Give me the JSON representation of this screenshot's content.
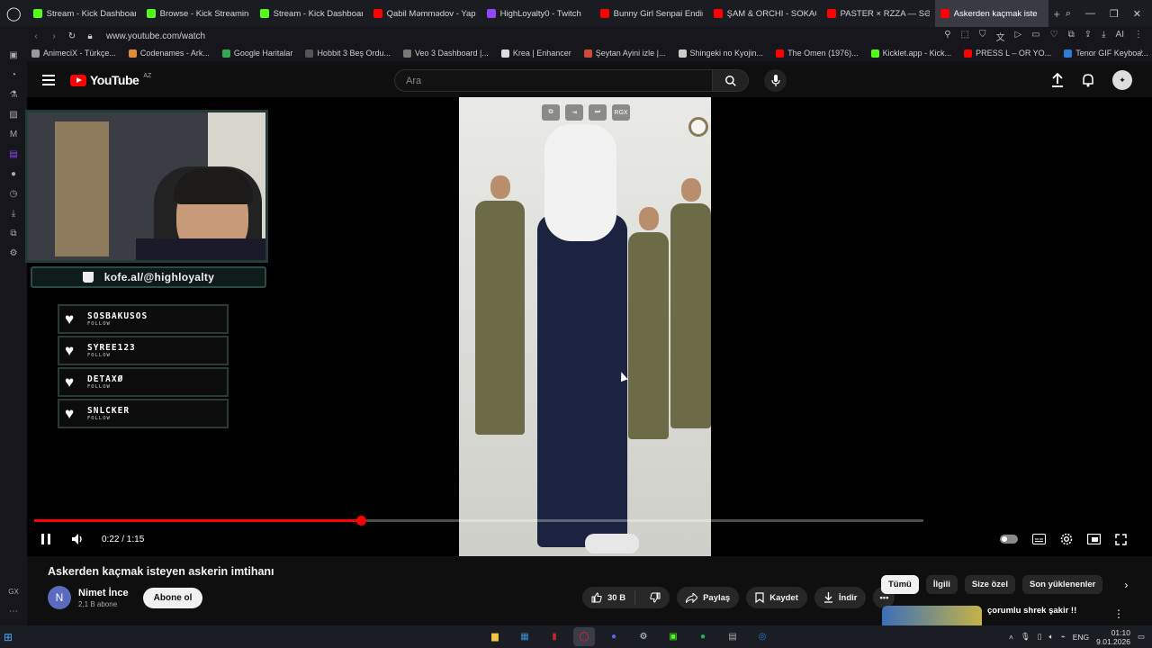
{
  "browser": {
    "tabs": [
      {
        "label": "Stream - Kick Dashboard",
        "color": "#53fc18"
      },
      {
        "label": "Browse - Kick Streaming",
        "color": "#53fc18"
      },
      {
        "label": "Stream - Kick Dashboard",
        "color": "#53fc18"
      },
      {
        "label": "Qabil Məmmədov - Yapar",
        "color": "#ff0000"
      },
      {
        "label": "HighLoyalty0 - Twitch",
        "color": "#9146ff"
      },
      {
        "label": "Bunny Girl Senpai Ending",
        "color": "#ff0000"
      },
      {
        "label": "ŞAM & ORCHI - SOKAĞIN",
        "color": "#ff0000"
      },
      {
        "label": "PASTER × RZZA — SƏNƏ",
        "color": "#ff0000"
      },
      {
        "label": "Askerden kaçmak iste",
        "color": "#ff0000",
        "active": true
      }
    ],
    "url": "www.youtube.com/watch",
    "bookmarks": [
      {
        "label": "AnimeciX - Türkçe...",
        "color": "#999999"
      },
      {
        "label": "Codenames - Ark...",
        "color": "#e08a3c"
      },
      {
        "label": "Google Haritalar",
        "color": "#34a853"
      },
      {
        "label": "Hobbit 3 Beş Ordu...",
        "color": "#555555"
      },
      {
        "label": "Veo 3 Dashboard |...",
        "color": "#777777"
      },
      {
        "label": "Krea | Enhancer",
        "color": "#dddddd"
      },
      {
        "label": "Şeytan Ayini izle |...",
        "color": "#d14836"
      },
      {
        "label": "Shingeki no Kyojin...",
        "color": "#cccccc"
      },
      {
        "label": "The Omen (1976)...",
        "color": "#ff0000"
      },
      {
        "label": "Kicklet.app - Kick...",
        "color": "#53fc18"
      },
      {
        "label": "PRESS L – OR YO...",
        "color": "#ff0000"
      },
      {
        "label": "Tenor GIF Keyboa...",
        "color": "#2f7bd8"
      }
    ]
  },
  "youtube": {
    "logo": "YouTube",
    "region": "AZ",
    "search_placeholder": "Ara",
    "video": {
      "title": "Askerden kaçmak isteyen askerin imtihanı",
      "time_current": "0:22",
      "time_total": "1:15",
      "time_display": "0:22 / 1:15",
      "progress_fraction": 0.367,
      "overlay_badge": "RGX"
    },
    "channel": {
      "initial": "N",
      "name": "Nimet İnce",
      "subscribers": "2,1 B abone",
      "subscribe_label": "Abone ol"
    },
    "actions": {
      "likes": "30 B",
      "share": "Paylaş",
      "save": "Kaydet",
      "download": "İndir"
    },
    "chips": [
      "Tümü",
      "İlgili",
      "Size özel",
      "Son yüklenenler"
    ],
    "recommendation": {
      "title": "çorumlu shrek şakir !!"
    }
  },
  "stream_overlay": {
    "kofe": "kofe.al/@highloyalty",
    "followers": [
      {
        "name": "SOSBAKUSOS",
        "sub": "FOLLOW"
      },
      {
        "name": "SYREE123",
        "sub": "FOLLOW"
      },
      {
        "name": "DETAXØ",
        "sub": "FOLLOW"
      },
      {
        "name": "SNLCKER",
        "sub": "FOLLOW"
      }
    ]
  },
  "taskbar": {
    "lang": "ENG",
    "time": "01:10",
    "date": "9.01.2026"
  },
  "sidebar_label": "GX"
}
